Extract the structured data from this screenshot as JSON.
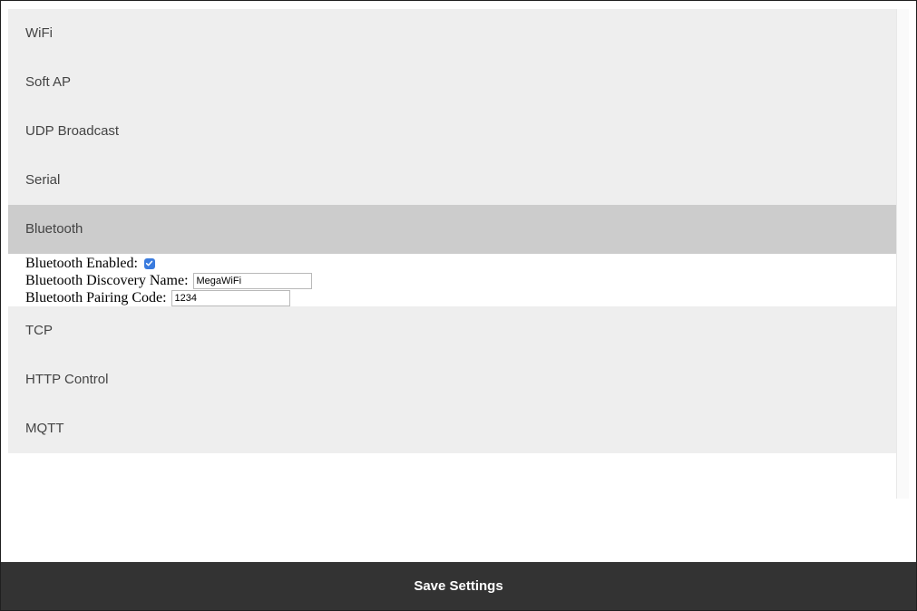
{
  "sections": {
    "wifi": "WiFi",
    "soft_ap": "Soft AP",
    "udp_broadcast": "UDP Broadcast",
    "serial": "Serial",
    "bluetooth": "Bluetooth",
    "tcp": "TCP",
    "http_control": "HTTP Control",
    "mqtt": "MQTT"
  },
  "bluetooth_panel": {
    "enabled_label": "Bluetooth Enabled:",
    "enabled": true,
    "discovery_name_label": "Bluetooth Discovery Name:",
    "discovery_name_value": "MegaWiFi",
    "pairing_code_label": "Bluetooth Pairing Code:",
    "pairing_code_value": "1234"
  },
  "footer": {
    "save_label": "Save Settings"
  },
  "colors": {
    "header_bg": "#eeeeee",
    "active_header_bg": "#cccccc",
    "footer_bg": "#333333",
    "checkbox_accent": "#3a7bde"
  },
  "icons": {
    "checkbox": "checkmark-icon"
  }
}
